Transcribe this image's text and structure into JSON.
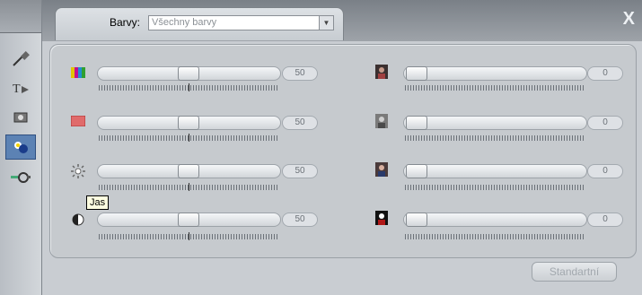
{
  "window": {
    "close_label": "X"
  },
  "header": {
    "barvy_label": "Barvy:",
    "color_select_value": "Všechny barvy"
  },
  "sidebar": {
    "items": [
      {
        "name": "eyedropper-icon"
      },
      {
        "name": "text-tool-icon"
      },
      {
        "name": "camera-icon"
      },
      {
        "name": "color-adjust-icon",
        "selected": true
      },
      {
        "name": "effects-icon"
      }
    ]
  },
  "left_sliders": [
    {
      "icon": "hue-icon",
      "value": "50"
    },
    {
      "icon": "saturation-icon",
      "value": "50"
    },
    {
      "icon": "brightness-icon",
      "value": "50"
    },
    {
      "icon": "contrast-icon",
      "value": "50"
    }
  ],
  "right_sliders": [
    {
      "icon": "portrait-1-icon",
      "value": "0"
    },
    {
      "icon": "portrait-2-icon",
      "value": "0"
    },
    {
      "icon": "portrait-3-icon",
      "value": "0"
    },
    {
      "icon": "portrait-4-icon",
      "value": "0"
    }
  ],
  "tooltip": {
    "text": "Jas"
  },
  "footer": {
    "standard_label": "Standartní"
  }
}
